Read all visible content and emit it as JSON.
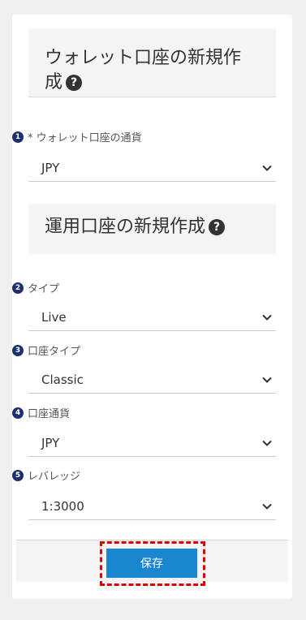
{
  "wallet_section": {
    "title_line1": "ウォレット口座の新規作",
    "title_line2": "成",
    "help_icon": "question-circle-icon",
    "currency_field": {
      "step": "1",
      "label": "* ウォレット口座の通貨",
      "value": "JPY"
    }
  },
  "trading_section": {
    "title": "運用口座の新規作成",
    "help_icon": "question-circle-icon",
    "fields": [
      {
        "step": "2",
        "label": "タイプ",
        "value": "Live"
      },
      {
        "step": "3",
        "label": "口座タイプ",
        "value": "Classic"
      },
      {
        "step": "4",
        "label": "口座通貨",
        "value": "JPY"
      },
      {
        "step": "5",
        "label": "レバレッジ",
        "value": "1:3000"
      }
    ]
  },
  "footer": {
    "save_label": "保存"
  },
  "colors": {
    "accent": "#1a86d0",
    "step_badge": "#1e2f6e",
    "highlight": "#e00000"
  }
}
